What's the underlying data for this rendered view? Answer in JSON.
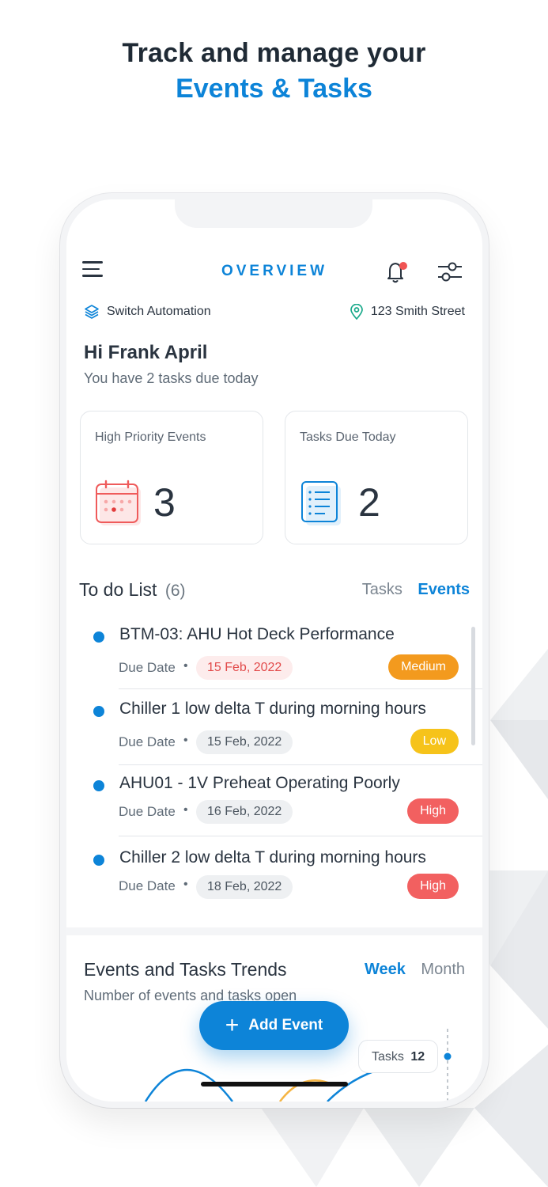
{
  "headline": {
    "line1": "Track and manage your",
    "line2": "Events & Tasks"
  },
  "colors": {
    "accent": "#0d84d8",
    "medium": "#f39a1e",
    "low": "#f6c31a",
    "high": "#f26060"
  },
  "header": {
    "title": "OVERVIEW",
    "menu_icon": "hamburger-menu-icon",
    "bell_icon": "bell-icon",
    "filter_icon": "sliders-icon"
  },
  "org": {
    "company": "Switch Automation",
    "address": "123 Smith Street"
  },
  "greeting": {
    "hello": "Hi Frank April",
    "sub": "You have 2 tasks due today"
  },
  "cards": [
    {
      "title": "High Priority Events",
      "value": "3",
      "icon": "calendar-icon"
    },
    {
      "title": "Tasks Due Today",
      "value": "2",
      "icon": "list-document-icon"
    }
  ],
  "todo": {
    "title": "To do List",
    "count": "(6)",
    "tabs": {
      "tasks": "Tasks",
      "events": "Events"
    },
    "due_label": "Due Date",
    "bullet": "•",
    "items": [
      {
        "title": "BTM-03: AHU Hot Deck Performance",
        "date": "15 Feb, 2022",
        "priority": "Medium"
      },
      {
        "title": "Chiller 1 low delta T during morning hours",
        "date": "15 Feb, 2022",
        "priority": "Low"
      },
      {
        "title": "AHU01 - 1V Preheat Operating Poorly",
        "date": "16 Feb, 2022",
        "priority": "High"
      },
      {
        "title": "Chiller 2 low delta T during morning hours",
        "date": "18 Feb, 2022",
        "priority": "High"
      }
    ]
  },
  "trends": {
    "title": "Events and Tasks Trends",
    "subtitle": "Number of events and tasks open",
    "tabs": {
      "week": "Week",
      "month": "Month"
    },
    "tooltip_label": "Tasks",
    "tooltip_value": "12"
  },
  "fab": {
    "label": "Add Event",
    "icon": "plus-icon"
  }
}
